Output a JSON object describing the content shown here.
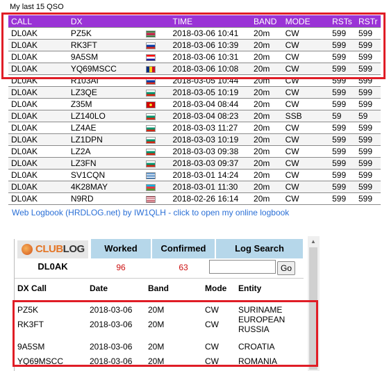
{
  "qso": {
    "caption": "My last 15 QSO",
    "headers": {
      "call": "CALL",
      "dx": "DX",
      "time": "TIME",
      "band": "BAND",
      "mode": "MODE",
      "rsts": "RSTs",
      "rstr": "RSTr"
    },
    "rows": [
      {
        "call": "DL0AK",
        "dx": "PZ5K",
        "flag": "suriname-flag",
        "time": "2018-03-06 10:41",
        "band": "20m",
        "mode": "CW",
        "rsts": "599",
        "rstr": "599"
      },
      {
        "call": "DL0AK",
        "dx": "RK3FT",
        "flag": "russia-flag",
        "time": "2018-03-06 10:39",
        "band": "20m",
        "mode": "CW",
        "rsts": "599",
        "rstr": "599"
      },
      {
        "call": "DL0AK",
        "dx": "9A5SM",
        "flag": "croatia-flag",
        "time": "2018-03-06 10:31",
        "band": "20m",
        "mode": "CW",
        "rsts": "599",
        "rstr": "599"
      },
      {
        "call": "DL0AK",
        "dx": "YQ69MSCC",
        "flag": "romania-flag",
        "time": "2018-03-06 10:08",
        "band": "20m",
        "mode": "CW",
        "rsts": "599",
        "rstr": "599"
      },
      {
        "call": "DL0AK",
        "dx": "R103AI",
        "flag": "russia-flag",
        "time": "2018-03-05 10:44",
        "band": "20m",
        "mode": "CW",
        "rsts": "599",
        "rstr": "599"
      },
      {
        "call": "DL0AK",
        "dx": "LZ3QE",
        "flag": "bulgaria-flag",
        "time": "2018-03-05 10:19",
        "band": "20m",
        "mode": "CW",
        "rsts": "599",
        "rstr": "599"
      },
      {
        "call": "DL0AK",
        "dx": "Z35M",
        "flag": "macedonia-flag",
        "time": "2018-03-04 08:44",
        "band": "20m",
        "mode": "CW",
        "rsts": "599",
        "rstr": "599"
      },
      {
        "call": "DL0AK",
        "dx": "LZ140LO",
        "flag": "bulgaria-flag",
        "time": "2018-03-04 08:23",
        "band": "20m",
        "mode": "SSB",
        "rsts": "59",
        "rstr": "59"
      },
      {
        "call": "DL0AK",
        "dx": "LZ4AE",
        "flag": "bulgaria-flag",
        "time": "2018-03-03 11:27",
        "band": "20m",
        "mode": "CW",
        "rsts": "599",
        "rstr": "599"
      },
      {
        "call": "DL0AK",
        "dx": "LZ1DPN",
        "flag": "bulgaria-flag",
        "time": "2018-03-03 10:19",
        "band": "20m",
        "mode": "CW",
        "rsts": "599",
        "rstr": "599"
      },
      {
        "call": "DL0AK",
        "dx": "LZ2A",
        "flag": "bulgaria-flag",
        "time": "2018-03-03 09:38",
        "band": "20m",
        "mode": "CW",
        "rsts": "599",
        "rstr": "599"
      },
      {
        "call": "DL0AK",
        "dx": "LZ3FN",
        "flag": "bulgaria-flag",
        "time": "2018-03-03 09:37",
        "band": "20m",
        "mode": "CW",
        "rsts": "599",
        "rstr": "599"
      },
      {
        "call": "DL0AK",
        "dx": "SV1CQN",
        "flag": "greece-flag",
        "time": "2018-03-01 14:24",
        "band": "20m",
        "mode": "CW",
        "rsts": "599",
        "rstr": "599"
      },
      {
        "call": "DL0AK",
        "dx": "4K28MAY",
        "flag": "azerbaijan-flag",
        "time": "2018-03-01 11:30",
        "band": "20m",
        "mode": "CW",
        "rsts": "599",
        "rstr": "599"
      },
      {
        "call": "DL0AK",
        "dx": "N9RD",
        "flag": "usa-flag",
        "time": "2018-02-26 16:14",
        "band": "20m",
        "mode": "CW",
        "rsts": "599",
        "rstr": "599"
      }
    ],
    "link": "Web Logbook (HRDLOG.net) by IW1QLH - click to open my online logbook"
  },
  "clublog": {
    "logo_a": "CLUB",
    "logo_b": "LOG",
    "callsign": "DL0AK",
    "worked_label": "Worked",
    "worked_value": "96",
    "confirmed_label": "Confirmed",
    "confirmed_value": "63",
    "search_label": "Log Search",
    "search_placeholder": "",
    "go_label": "Go",
    "columns": {
      "dxcall": "DX Call",
      "date": "Date",
      "band": "Band",
      "mode": "Mode",
      "entity": "Entity"
    },
    "rows": [
      {
        "dxcall": "PZ5K",
        "date": "2018-03-06",
        "band": "20M",
        "mode": "CW",
        "entity": "SURINAME"
      },
      {
        "dxcall": "RK3FT",
        "date": "2018-03-06",
        "band": "20M",
        "mode": "CW",
        "entity": "EUROPEAN RUSSIA"
      },
      {
        "dxcall": "9A5SM",
        "date": "2018-03-06",
        "band": "20M",
        "mode": "CW",
        "entity": "CROATIA"
      },
      {
        "dxcall": "YQ69MSCC",
        "date": "2018-03-06",
        "band": "20M",
        "mode": "CW",
        "entity": "ROMANIA"
      }
    ]
  },
  "flags": {
    "suriname-flag": "linear-gradient(#377e3f 0 25%, #fff 25% 32%, #b40a2d 32% 68%, #fff 68% 75%, #377e3f 75%)",
    "russia-flag": "linear-gradient(#fff 0 33%, #0039a6 33% 66%, #d52b1e 66%)",
    "croatia-flag": "linear-gradient(#ff0000 0 33%, #fff 33% 66%, #171796 66%)",
    "romania-flag": "linear-gradient(90deg, #002b7f 0 33%, #fcd116 33% 66%, #ce1126 66%)",
    "bulgaria-flag": "linear-gradient(#fff 0 33%, #00966e 33% 66%, #d62612 66%)",
    "macedonia-flag": "radial-gradient(circle, #f8e92e 0 25%, #d20000 26%)",
    "greece-flag": "repeating-linear-gradient(#0d5eaf 0 11%, #fff 11% 22%)",
    "azerbaijan-flag": "linear-gradient(#00b5e2 0 33%, #ef3340 33% 66%, #509e2f 66%)",
    "usa-flag": "repeating-linear-gradient(#b22234 0 15%, #fff 15% 30%)"
  }
}
